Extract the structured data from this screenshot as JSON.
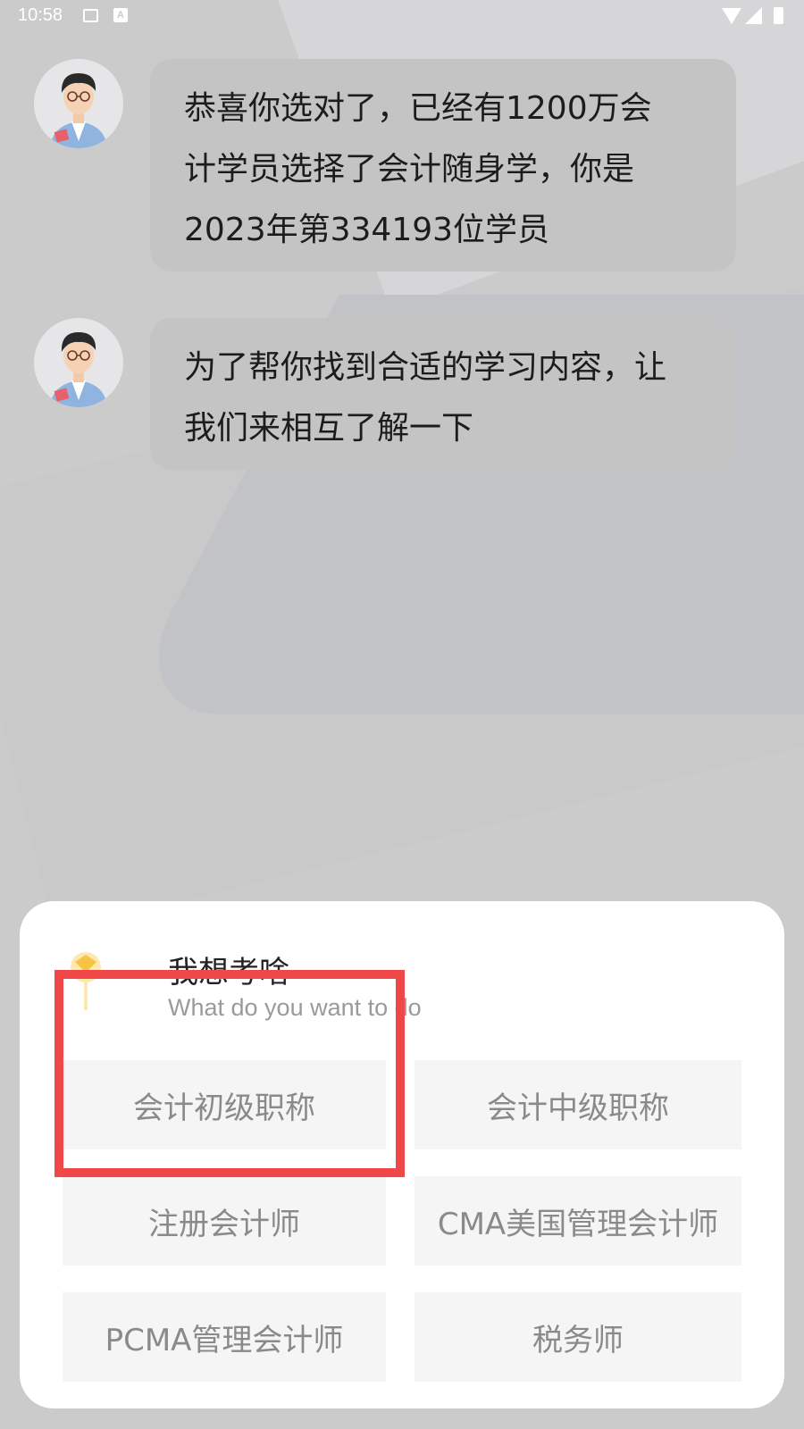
{
  "status_bar": {
    "time": "10:58",
    "icons": [
      "image-icon",
      "a-icon",
      "wifi-icon",
      "signal-icon",
      "battery-icon"
    ]
  },
  "messages": [
    {
      "avatar": "teacher-avatar",
      "text": "恭喜你选对了，已经有1200万会\n计学员选择了会计随身学，你是\n2023年第334193位学员"
    },
    {
      "avatar": "teacher-avatar",
      "text": "为了帮你找到合适的学习内容，让\n我们来相互了解一下"
    }
  ],
  "sheet": {
    "icon": "lightbulb-icon",
    "title": "我想考啥",
    "subtitle": "What do you want to do",
    "options": [
      "会计初级职称",
      "会计中级职称",
      "注册会计师",
      "CMA美国管理会计师",
      "PCMA管理会计师",
      "税务师"
    ]
  },
  "colors": {
    "background": "#cbcbcb",
    "bubble": "#c4c4c4",
    "sheet": "#ffffff",
    "option_bg": "#f5f5f5",
    "option_text": "#8a8a8a",
    "highlight": "#f04848"
  }
}
